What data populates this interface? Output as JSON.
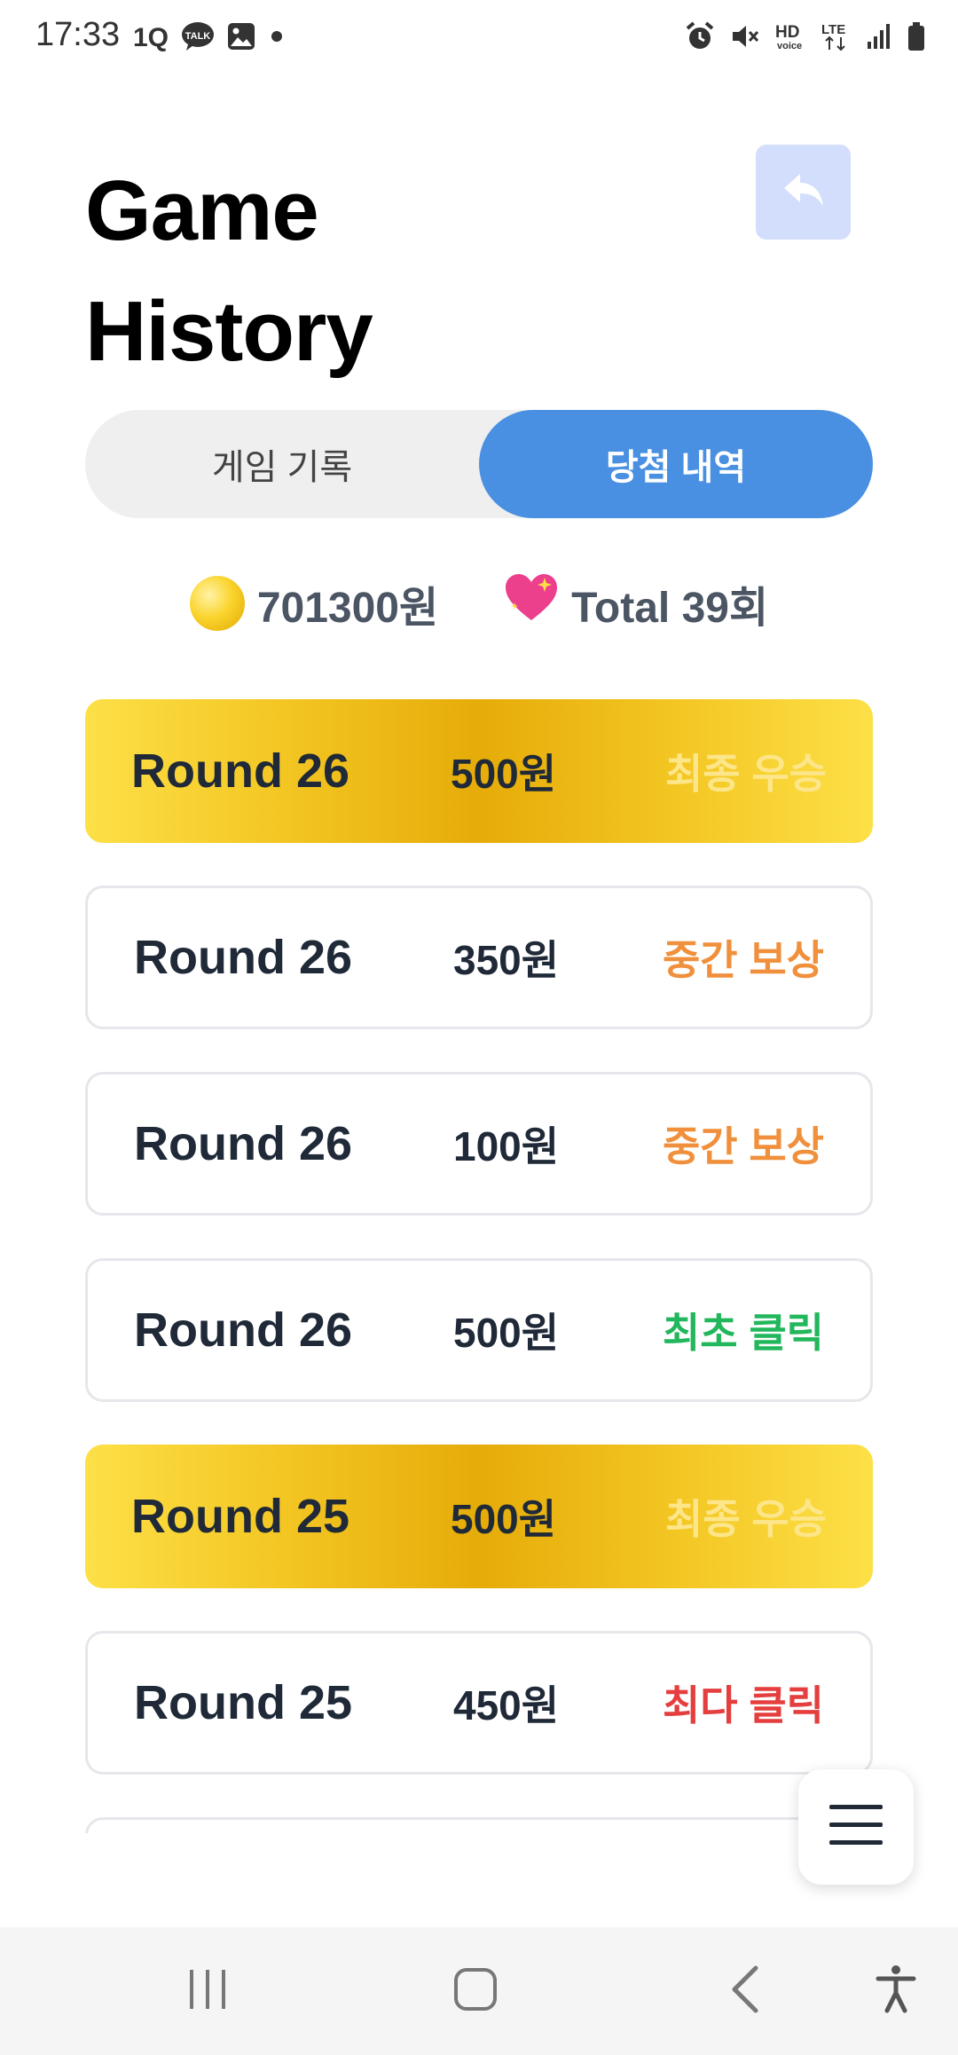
{
  "status_bar": {
    "time": "17:33",
    "left_icons": [
      "1Q-icon",
      "talk-icon",
      "gallery-icon",
      "dot-icon"
    ],
    "right_icons": [
      "alarm-icon",
      "mute-icon",
      "hd-voice-icon",
      "lte-icon",
      "signal-icon",
      "battery-icon"
    ],
    "hd_text": "HD",
    "voice_text": "voice",
    "lte_text": "LTE",
    "talk_text": "TALK"
  },
  "header": {
    "title_line1": "Game",
    "title_line2": "History"
  },
  "tabs": {
    "game_record": "게임 기록",
    "winning_history": "당첨 내역",
    "active": "winning_history"
  },
  "stats": {
    "coin_amount": "701300원",
    "total_label": "Total 39회"
  },
  "records": [
    {
      "round": "Round 26",
      "amount": "500원",
      "status": "최종 우승",
      "type": "final-win"
    },
    {
      "round": "Round 26",
      "amount": "350원",
      "status": "중간 보상",
      "type": "mid-reward"
    },
    {
      "round": "Round 26",
      "amount": "100원",
      "status": "중간 보상",
      "type": "mid-reward"
    },
    {
      "round": "Round 26",
      "amount": "500원",
      "status": "최초 클릭",
      "type": "first-click"
    },
    {
      "round": "Round 25",
      "amount": "500원",
      "status": "최종 우승",
      "type": "final-win"
    },
    {
      "round": "Round 25",
      "amount": "450원",
      "status": "최다 클릭",
      "type": "most-click"
    }
  ],
  "colors": {
    "accent_blue": "#4a90e2",
    "back_button_bg": "#d3defc",
    "gold": "#e6ac09",
    "mid_reward": "#f0903c",
    "first_click": "#22b75c",
    "most_click": "#e53e3e"
  }
}
